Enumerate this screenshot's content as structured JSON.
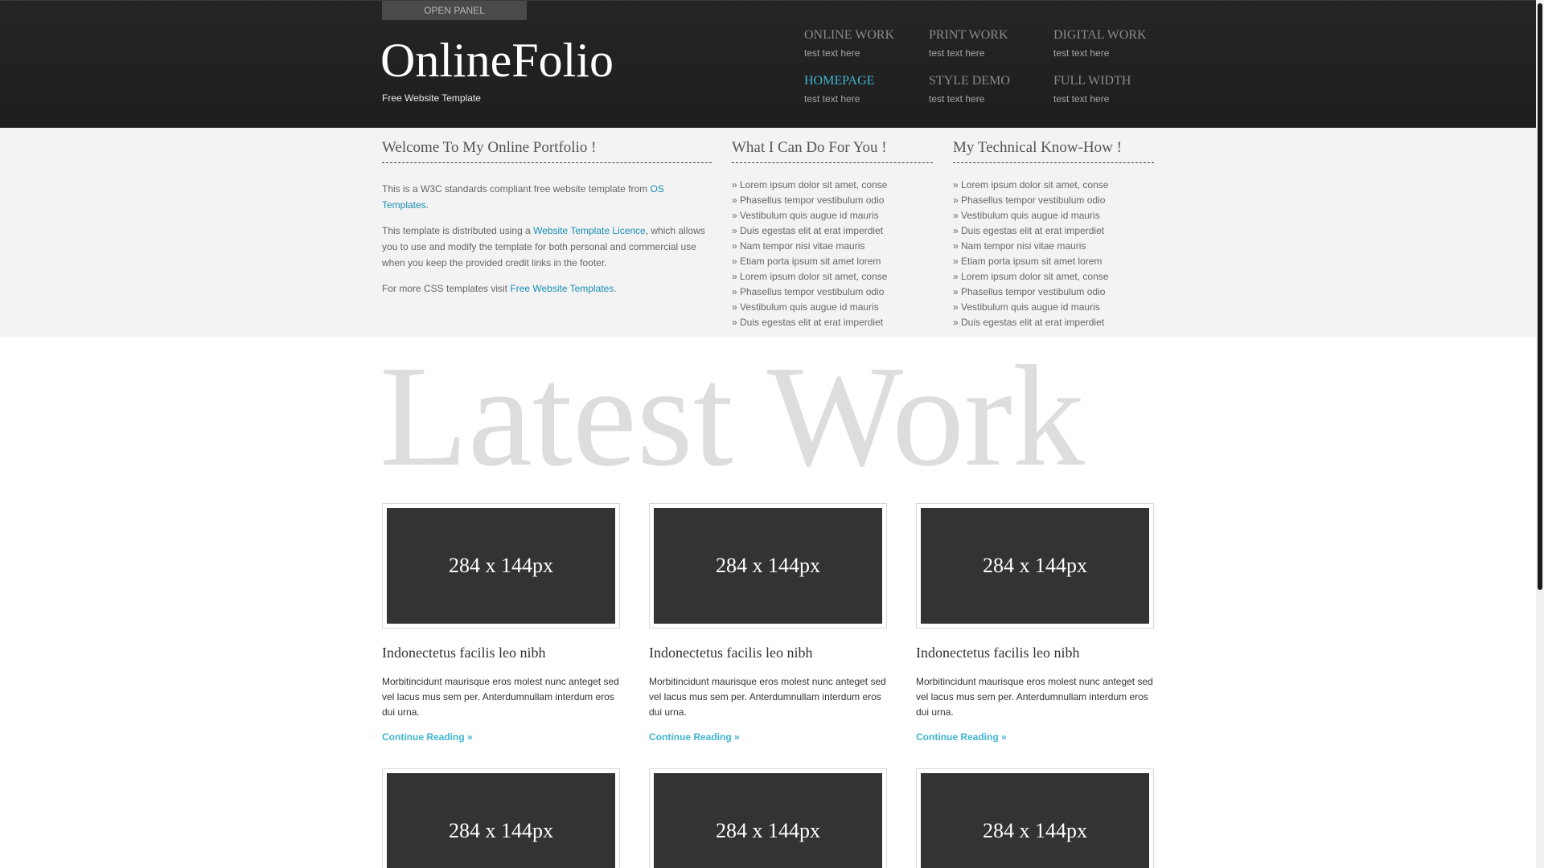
{
  "header": {
    "open_panel": "OPEN PANEL",
    "logo": "OnlineFolio",
    "tagline": "Free Website Template",
    "nav": [
      {
        "title": "ONLINE WORK",
        "sub": "test text here"
      },
      {
        "title": "PRINT WORK",
        "sub": "test text here"
      },
      {
        "title": "DIGITAL WORK",
        "sub": "test text here"
      },
      {
        "title": "HOMEPAGE",
        "sub": "test text here"
      },
      {
        "title": "STYLE DEMO",
        "sub": "test text here"
      },
      {
        "title": "FULL WIDTH",
        "sub": "test text here"
      }
    ]
  },
  "welcome": {
    "title": "Welcome To My Online Portfolio !",
    "p1_text": "This is a W3C standards compliant free website template from ",
    "p1_link": "OS Templates",
    "p1_end": ".",
    "p2_text": "This template is distributed using a ",
    "p2_link": "Website Template Licence",
    "p2_end": ", which allows you to use and modify the template for both personal and commercial use when you keep the provided credit links in the footer.",
    "p3_text": "For more CSS templates visit ",
    "p3_link": "Free Website Templates",
    "p3_end": "."
  },
  "services": {
    "title": "What I Can Do For You !",
    "items": [
      "» Lorem ipsum dolor sit amet, conse",
      "» Phasellus tempor vestibulum odio",
      "» Vestibulum quis augue id mauris",
      "» Duis egestas elit at erat imperdiet",
      "» Nam tempor nisi vitae mauris",
      "» Etiam porta ipsum sit amet lorem",
      "» Lorem ipsum dolor sit amet, conse",
      "» Phasellus tempor vestibulum odio",
      "» Vestibulum quis augue id mauris",
      "» Duis egestas elit at erat imperdiet"
    ]
  },
  "knowhow": {
    "title": "My Technical Know-How !",
    "items": [
      "» Lorem ipsum dolor sit amet, conse",
      "» Phasellus tempor vestibulum odio",
      "» Vestibulum quis augue id mauris",
      "» Duis egestas elit at erat imperdiet",
      "» Nam tempor nisi vitae mauris",
      "» Etiam porta ipsum sit amet lorem",
      "» Lorem ipsum dolor sit amet, conse",
      "» Phasellus tempor vestibulum odio",
      "» Vestibulum quis augue id mauris",
      "» Duis egestas elit at erat imperdiet"
    ]
  },
  "latest": {
    "title": "Latest Work",
    "cards": [
      {
        "thumb": "284 x 144px",
        "title": "Indonectetus facilis leo nibh",
        "text": "Morbitincidunt maurisque eros molest nunc anteget sed vel lacus mus sem per. Anterdumnullam interdum eros dui urna.",
        "link": "Continue Reading »"
      },
      {
        "thumb": "284 x 144px",
        "title": "Indonectetus facilis leo nibh",
        "text": "Morbitincidunt maurisque eros molest nunc anteget sed vel lacus mus sem per. Anterdumnullam interdum eros dui urna.",
        "link": "Continue Reading »"
      },
      {
        "thumb": "284 x 144px",
        "title": "Indonectetus facilis leo nibh",
        "text": "Morbitincidunt maurisque eros molest nunc anteget sed vel lacus mus sem per. Anterdumnullam interdum eros dui urna.",
        "link": "Continue Reading »"
      },
      {
        "thumb": "284 x 144px"
      },
      {
        "thumb": "284 x 144px"
      },
      {
        "thumb": "284 x 144px"
      }
    ]
  },
  "colors": {
    "header_bg": "#222222",
    "accent": "#3fb5d1",
    "intro_bg": "#f3f3f3",
    "thumb_bg": "#333333"
  }
}
